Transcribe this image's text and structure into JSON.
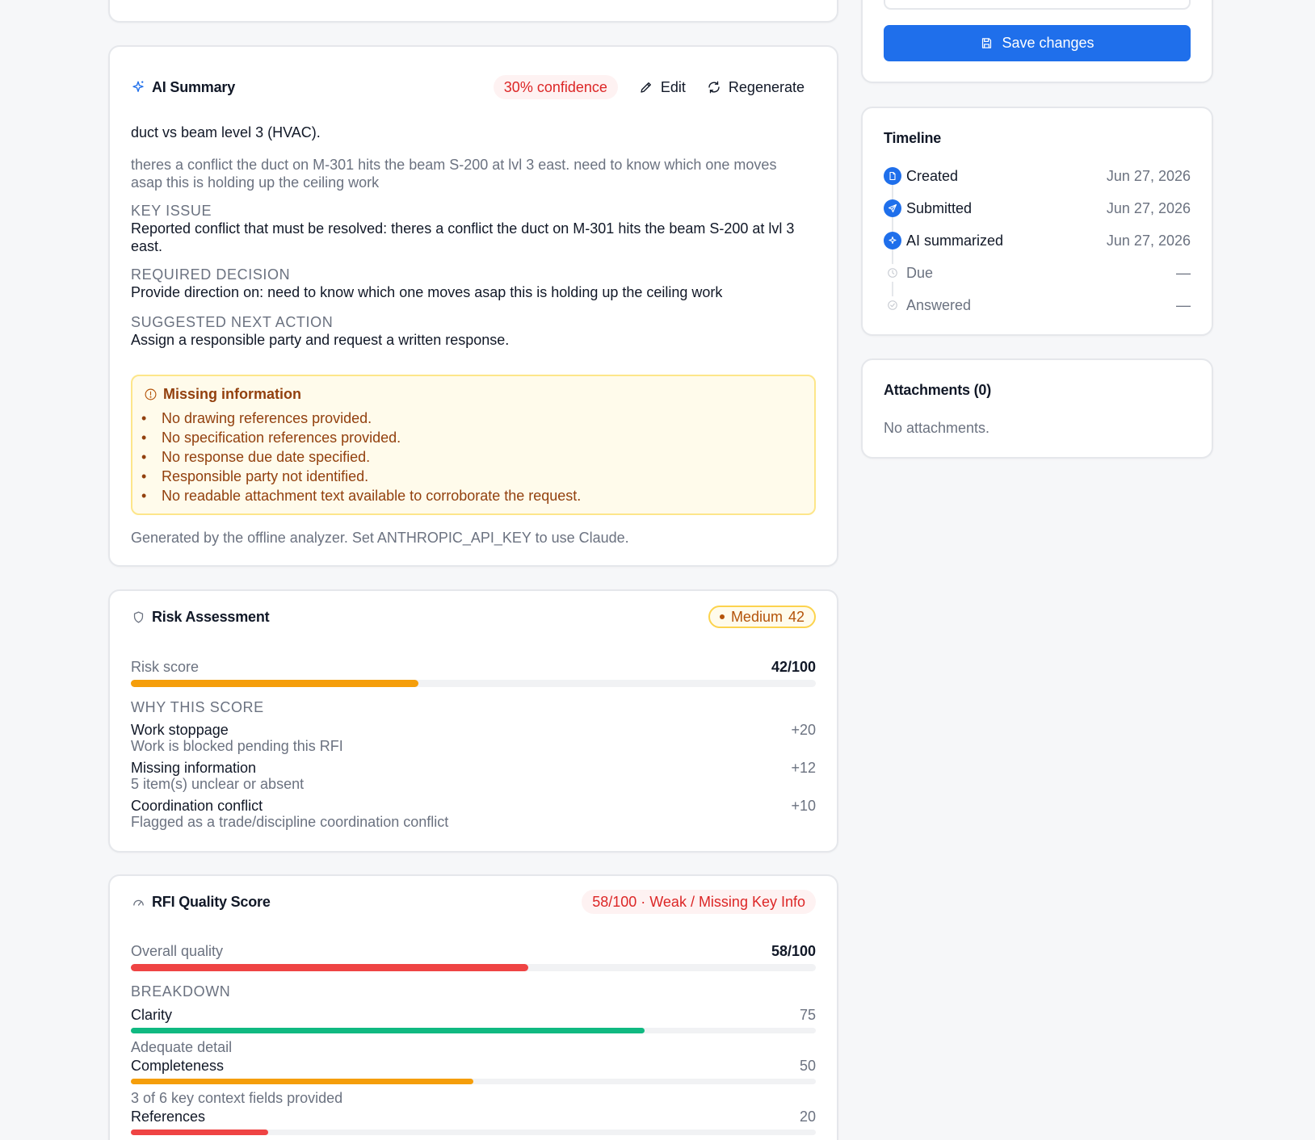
{
  "summary": {
    "title": "AI Summary",
    "confidence": "30% confidence",
    "edit_label": "Edit",
    "regenerate_label": "Regenerate",
    "subject": "duct vs beam level 3 (HVAC).",
    "original_text": "theres a conflict the duct on M-301 hits the beam S-200 at lvl 3 east. need to know which one moves asap this is holding up the ceiling work",
    "key_issue_label": "KEY ISSUE",
    "key_issue": "Reported conflict that must be resolved: theres a conflict the duct on M-301 hits the beam S-200 at lvl 3 east.",
    "required_decision_label": "REQUIRED DECISION",
    "required_decision": "Provide direction on: need to know which one moves asap this is holding up the ceiling work",
    "next_action_label": "SUGGESTED NEXT ACTION",
    "next_action": "Assign a responsible party and request a written response.",
    "missing_title": "Missing information",
    "missing_items": [
      "No drawing references provided.",
      "No specification references provided.",
      "No response due date specified.",
      "Responsible party not identified.",
      "No readable attachment text available to corroborate the request."
    ],
    "footer": "Generated by the offline analyzer. Set ANTHROPIC_API_KEY to use Claude."
  },
  "risk": {
    "title": "Risk Assessment",
    "badge_level": "Medium",
    "badge_value": "42",
    "score_label": "Risk score",
    "score_text": "42/100",
    "score_value": 42,
    "why_label": "WHY THIS SCORE",
    "reasons": [
      {
        "title": "Work stoppage",
        "sub": "Work is blocked pending this RFI",
        "points": "+20"
      },
      {
        "title": "Missing information",
        "sub": "5 item(s) unclear or absent",
        "points": "+12"
      },
      {
        "title": "Coordination conflict",
        "sub": "Flagged as a trade/discipline coordination conflict",
        "points": "+10"
      }
    ]
  },
  "quality": {
    "title": "RFI Quality Score",
    "badge": "58/100 · Weak / Missing Key Info",
    "overall_label": "Overall quality",
    "overall_text": "58/100",
    "overall_value": 58,
    "breakdown_label": "BREAKDOWN",
    "items": [
      {
        "label": "Clarity",
        "value": 75,
        "value_text": "75",
        "note": "Adequate detail",
        "color": "#10b981"
      },
      {
        "label": "Completeness",
        "value": 50,
        "value_text": "50",
        "note": "3 of 6 key context fields provided",
        "color": "#f59e0b"
      },
      {
        "label": "References",
        "value": 20,
        "value_text": "20",
        "note": "",
        "color": "#ef4444"
      }
    ]
  },
  "sidebar": {
    "save_label": "Save changes",
    "timeline_title": "Timeline",
    "timeline": [
      {
        "label": "Created",
        "date": "Jun 27, 2026",
        "done": true,
        "icon": "file-icon"
      },
      {
        "label": "Submitted",
        "date": "Jun 27, 2026",
        "done": true,
        "icon": "send-icon"
      },
      {
        "label": "AI summarized",
        "date": "Jun 27, 2026",
        "done": true,
        "icon": "sparkle-icon"
      },
      {
        "label": "Due",
        "date": "—",
        "done": false,
        "icon": "clock-icon"
      },
      {
        "label": "Answered",
        "date": "—",
        "done": false,
        "icon": "check-circle-icon"
      }
    ],
    "attachments_title": "Attachments (0)",
    "attachments_empty": "No attachments."
  },
  "colors": {
    "primary": "#1f6feb",
    "danger": "#ef4444",
    "warning": "#f59e0b",
    "success": "#10b981",
    "warn_bg": "#fffbeb",
    "warn_border": "#fde68a",
    "warn_text": "#92400e"
  }
}
